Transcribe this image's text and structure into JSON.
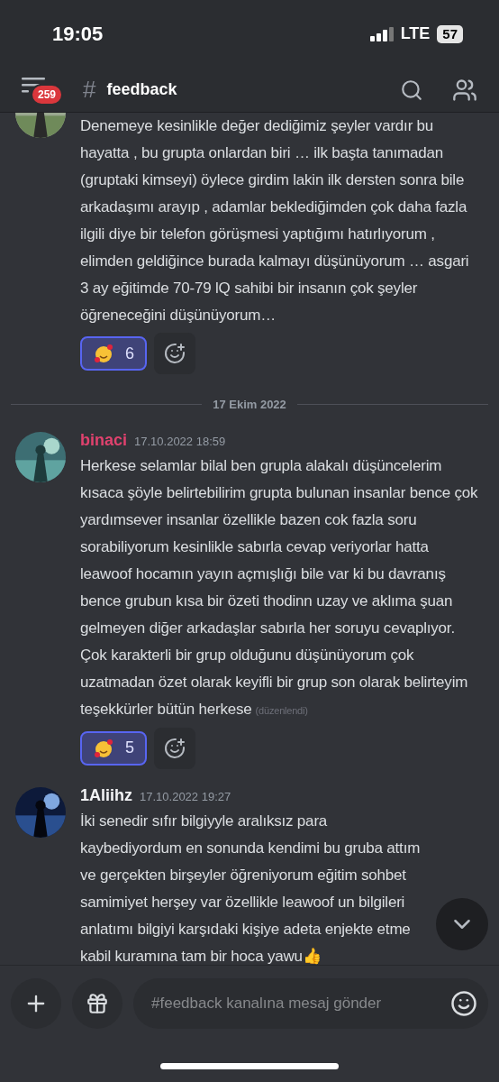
{
  "status_bar": {
    "time": "19:05",
    "network": "LTE",
    "battery": "57"
  },
  "header": {
    "badge": "259",
    "hash": "#",
    "channel": "feedback"
  },
  "messages": [
    {
      "kind": "continued",
      "text": "Denemeye kesinlikle değer dediğimiz şeyler vardır bu hayatta , bu grupta onlardan biri … ilk başta tanımadan (gruptaki kimseyi) öylece girdim lakin ilk dersten sonra bile arkadaşımı arayıp , adamlar beklediğimden çok daha fazla ilgili diye bir telefon görüşmesi yaptığımı hatırlıyorum , elimden geldiğince burada kalmayı düşünüyorum … asgari 3 ay eğitimde 70-79 lQ sahibi bir insanın çok şeyler öğreneceğini düşünüyorum…",
      "reactions": [
        {
          "count": "6",
          "selected": true
        }
      ]
    },
    {
      "kind": "divider",
      "text": "17 Ekim 2022"
    },
    {
      "kind": "message",
      "author": "binaci",
      "color": "#e0426e",
      "time": "17.10.2022 18:59",
      "text": "Herkese selamlar bilal ben grupla alakalı düşüncelerim kısaca şöyle belirtebilirim grupta bulunan insanlar bence çok yardımsever insanlar özellikle bazen cok fazla soru sorabiliyorum kesinlikle sabırla cevap veriyorlar hatta leawoof hocamın yayın açmışlığı bile var ki bu davranış bence grubun kısa bir özeti thodinn uzay ve aklıma şuan gelmeyen diğer arkadaşlar sabırla her soruyu cevaplıyor. Çok karakterli bir grup olduğunu düşünüyorum çok uzatmadan özet olarak keyifli bir grup son olarak belirteyim teşekkürler bütün herkese",
      "edited": "(düzenlendi)",
      "reactions": [
        {
          "count": "5",
          "selected": true
        }
      ]
    },
    {
      "kind": "message",
      "author": "1Aliihz",
      "color": "#f2f3f5",
      "time": "17.10.2022 19:27",
      "text": "İki senedir sıfır bilgiyyle aralıksız para kaybediyordum en sonunda kendimi bu gruba attım ve gerçekten birşeyler öğreniyorum  eğitim sohbet samimiyet herşey var özellikle leawoof un bilgileri anlatımı bilgiyi karşıdaki kişiye adeta enjekte etme kabil kuramına  tam bir hoca yawu👍"
    }
  ],
  "composer": {
    "placeholder": "#feedback kanalına mesaj gönder"
  }
}
